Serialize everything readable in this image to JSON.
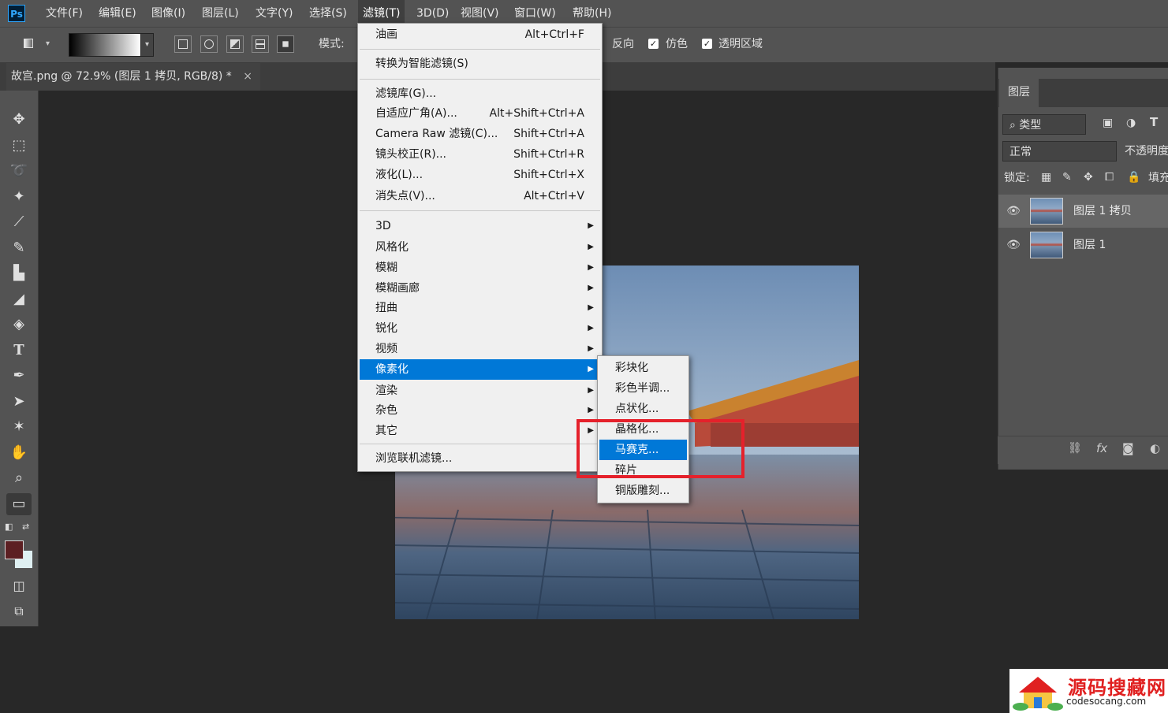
{
  "app": {
    "logo": "Ps",
    "menus": [
      "文件(F)",
      "编辑(E)",
      "图像(I)",
      "图层(L)",
      "文字(Y)",
      "选择(S)",
      "滤镜(T)",
      "3D(D)",
      "视图(V)",
      "窗口(W)",
      "帮助(H)"
    ],
    "active_menu": "滤镜(T)"
  },
  "options_bar": {
    "mode_label": "模式:",
    "reverse_label": "反向",
    "dither_label": "仿色",
    "transparency_label": "透明区域"
  },
  "document": {
    "tab_title": "故宫.png @ 72.9% (图层 1 拷贝, RGB/8) *",
    "close_glyph": "×"
  },
  "filter_menu": {
    "items": [
      {
        "label": "油画",
        "shortcut": "Alt+Ctrl+F"
      },
      {
        "label": "转换为智能滤镜(S)",
        "shortcut": ""
      },
      {
        "label": "滤镜库(G)...",
        "shortcut": ""
      },
      {
        "label": "自适应广角(A)...",
        "shortcut": "Alt+Shift+Ctrl+A"
      },
      {
        "label": "Camera Raw 滤镜(C)...",
        "shortcut": "Shift+Ctrl+A"
      },
      {
        "label": "镜头校正(R)...",
        "shortcut": "Shift+Ctrl+R"
      },
      {
        "label": "液化(L)...",
        "shortcut": "Shift+Ctrl+X"
      },
      {
        "label": "消失点(V)...",
        "shortcut": "Alt+Ctrl+V"
      },
      {
        "label": "3D",
        "shortcut": ""
      },
      {
        "label": "风格化",
        "shortcut": ""
      },
      {
        "label": "模糊",
        "shortcut": ""
      },
      {
        "label": "模糊画廊",
        "shortcut": ""
      },
      {
        "label": "扭曲",
        "shortcut": ""
      },
      {
        "label": "锐化",
        "shortcut": ""
      },
      {
        "label": "视频",
        "shortcut": ""
      },
      {
        "label": "像素化",
        "shortcut": ""
      },
      {
        "label": "渲染",
        "shortcut": ""
      },
      {
        "label": "杂色",
        "shortcut": ""
      },
      {
        "label": "其它",
        "shortcut": ""
      },
      {
        "label": "浏览联机滤镜...",
        "shortcut": ""
      }
    ]
  },
  "pixelate_submenu": {
    "items": [
      "彩块化",
      "彩色半调...",
      "点状化...",
      "晶格化...",
      "马赛克...",
      "碎片",
      "铜版雕刻..."
    ],
    "highlighted": "马赛克..."
  },
  "layers_panel": {
    "tab_label": "图层",
    "filter_kind": "类型",
    "blend_mode": "正常",
    "opacity_label": "不透明度",
    "lock_label": "锁定:",
    "fill_label": "填充",
    "layers": [
      {
        "name": "图层 1 拷贝",
        "selected": true
      },
      {
        "name": "图层 1",
        "selected": false
      }
    ],
    "footer_fx": "fx"
  },
  "watermark": {
    "title": "源码搜藏网",
    "subtitle": "codesocang.com"
  },
  "colors": {
    "foreground": "#5c1f22",
    "background": "#dff0f2",
    "highlight": "#0078d7",
    "annotation_box": "#e5212b"
  }
}
